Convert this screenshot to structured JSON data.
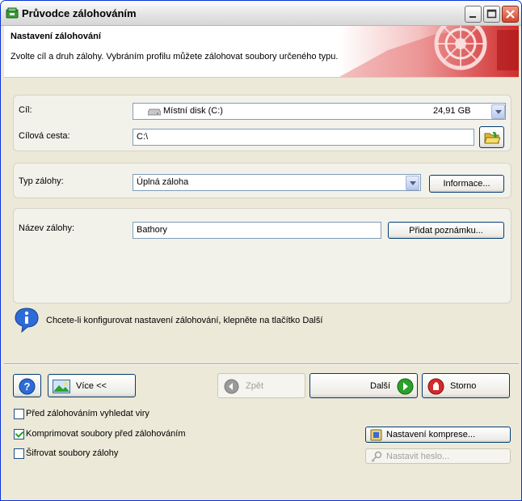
{
  "window": {
    "title": "Průvodce zálohováním"
  },
  "header": {
    "title": "Nastavení zálohování",
    "subtitle": "Zvolte cíl a druh zálohy. Vybráním profilu můžete zálohovat soubory určeného typu."
  },
  "target": {
    "label": "Cíl:",
    "drive_name": "Místní disk (C:)",
    "drive_size": "24,91 GB",
    "path_label": "Cílová cesta:",
    "path_value": "C:\\"
  },
  "backup_type": {
    "label": "Typ zálohy:",
    "value": "Úplná záloha",
    "info_button": "Informace..."
  },
  "backup_name": {
    "label": "Název zálohy:",
    "value": "Bathory",
    "note_button": "Přidat poznámku..."
  },
  "info_message": "Chcete-li konfigurovat nastavení zálohování, klepněte na tlačítko Další",
  "buttons": {
    "more": "Více <<",
    "back": "Zpět",
    "next": "Další",
    "cancel": "Storno",
    "compression_settings": "Nastavení komprese...",
    "set_password": "Nastavit heslo..."
  },
  "options": {
    "virus_scan": {
      "label": "Před zálohováním vyhledat viry",
      "checked": false
    },
    "compress": {
      "label": "Komprimovat soubory před zálohováním",
      "checked": true
    },
    "encrypt": {
      "label": "Šifrovat soubory zálohy",
      "checked": false
    }
  },
  "colors": {
    "title_accent": "#0831d9",
    "header_art": "#d42a2a"
  }
}
